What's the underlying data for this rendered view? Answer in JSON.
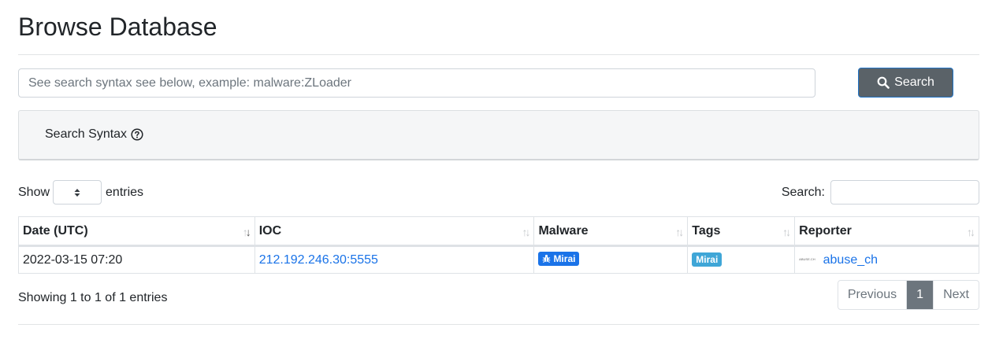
{
  "page": {
    "title": "Browse Database"
  },
  "search": {
    "placeholder": "See search syntax see below, example: malware:ZLoader",
    "value": "",
    "button_label": "Search"
  },
  "syntax": {
    "label": "Search Syntax"
  },
  "length_control": {
    "prefix": "Show",
    "suffix": "entries",
    "selected": ""
  },
  "filter_control": {
    "label": "Search:",
    "value": ""
  },
  "table": {
    "columns": [
      "Date (UTC)",
      "IOC",
      "Malware",
      "Tags",
      "Reporter"
    ],
    "rows": [
      {
        "date": "2022-03-15 07:20",
        "ioc": "212.192.246.30:5555",
        "malware": "Mirai",
        "tags": [
          "Mirai"
        ],
        "reporter": "abuse_ch",
        "reporter_logo": "ABUSE.CH"
      }
    ]
  },
  "info": "Showing 1 to 1 of 1 entries",
  "pagination": {
    "previous": "Previous",
    "current": "1",
    "next": "Next"
  },
  "colors": {
    "link": "#1a73e8",
    "malware_badge": "#1a73e8",
    "tag_badge": "#3fa6d7",
    "search_button": "#5a6268",
    "current_page": "#6c757d"
  },
  "icons": {
    "search_button": "search-icon",
    "syntax": "question-circle-icon",
    "malware_badge": "bug-icon",
    "select": "sort-arrows-icon"
  }
}
